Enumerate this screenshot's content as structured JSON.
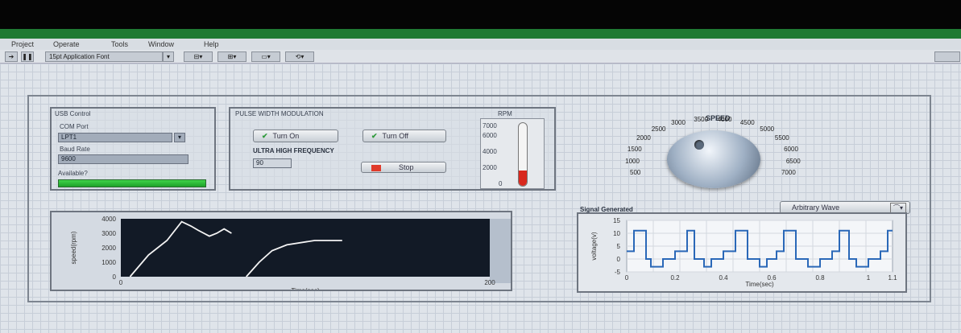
{
  "menu": [
    "Project",
    "Operate",
    "Tools",
    "Window",
    "Help"
  ],
  "toolbar": {
    "font_select": "15pt Application Font"
  },
  "usb": {
    "title": "USB Control",
    "com_label": "COM Port",
    "com_value": "LPT1",
    "baud_label": "Baud Rate",
    "baud_value": "9600",
    "available_label": "Available?"
  },
  "pwm": {
    "title": "PULSE WIDTH MODULATION",
    "turn_on": "Turn On",
    "turn_off": "Turn Off",
    "uhf_label": "ULTRA HIGH FREQUENCY",
    "uhf_value": "90",
    "stop": "Stop"
  },
  "rpm": {
    "title": "RPM",
    "ticks": [
      "7000",
      "6000",
      "4000",
      "2000",
      "0"
    ],
    "level_fraction": 0.25
  },
  "speed": {
    "title": "SPEED",
    "ticks": [
      "500",
      "1000",
      "1500",
      "2000",
      "2500",
      "3000",
      "3500",
      "4000",
      "4500",
      "5000",
      "5500",
      "6000",
      "6500",
      "7000"
    ]
  },
  "wave_select": "Arbitrary Wave",
  "speed_chart": {
    "ylabel": "speed(rpm)",
    "xlabel": "Time(sec)",
    "yticks": [
      "4000",
      "3000",
      "2000",
      "1000",
      "0"
    ],
    "xticks": [
      "0",
      "200"
    ]
  },
  "signal_chart": {
    "title": "Signal Generated",
    "ylabel": "voltage(v)",
    "xlabel": "Time(sec)",
    "yticks": [
      "15",
      "10",
      "5",
      "0",
      "-5"
    ],
    "xticks": [
      "0",
      "0.2",
      "0.4",
      "0.6",
      "0.8",
      "1",
      "1.1"
    ]
  },
  "chart_data": [
    {
      "type": "line",
      "xlabel": "Time(sec)",
      "ylabel": "speed(rpm)",
      "xlim": [
        0,
        200
      ],
      "ylim": [
        0,
        4000
      ],
      "series": [
        {
          "x": [
            5,
            15,
            25,
            33,
            38,
            42,
            48,
            52,
            56,
            60
          ],
          "y": [
            0,
            1500,
            2500,
            3800,
            3500,
            3200,
            2800,
            3000,
            3300,
            3000
          ]
        },
        {
          "x": [
            68,
            75,
            82,
            90,
            105,
            120
          ],
          "y": [
            0,
            1000,
            1800,
            2200,
            2500,
            2500
          ]
        }
      ]
    },
    {
      "type": "line",
      "title": "Signal Generated",
      "xlabel": "Time(sec)",
      "ylabel": "voltage(v)",
      "xlim": [
        0,
        1.1
      ],
      "ylim": [
        -5,
        15
      ],
      "series": [
        {
          "x": [
            0,
            0.03,
            0.03,
            0.08,
            0.08,
            0.1,
            0.1,
            0.15,
            0.15,
            0.2,
            0.2,
            0.25,
            0.25,
            0.28,
            0.28,
            0.32,
            0.32,
            0.35,
            0.35,
            0.4,
            0.4,
            0.45,
            0.45,
            0.5,
            0.5,
            0.55,
            0.55,
            0.58,
            0.58,
            0.62,
            0.62,
            0.65,
            0.65,
            0.7,
            0.7,
            0.75,
            0.75,
            0.8,
            0.8,
            0.85,
            0.85,
            0.88,
            0.88,
            0.92,
            0.92,
            0.95,
            0.95,
            1.0,
            1.0,
            1.05,
            1.05,
            1.08,
            1.08,
            1.1
          ],
          "y": [
            3,
            3,
            11,
            11,
            0,
            0,
            -3,
            -3,
            0,
            0,
            3,
            3,
            11,
            11,
            0,
            0,
            -3,
            -3,
            0,
            0,
            3,
            3,
            11,
            11,
            0,
            0,
            -3,
            -3,
            0,
            0,
            3,
            3,
            11,
            11,
            0,
            0,
            -3,
            -3,
            0,
            0,
            3,
            3,
            11,
            11,
            0,
            0,
            -3,
            -3,
            0,
            0,
            3,
            3,
            11,
            11
          ]
        }
      ]
    }
  ]
}
